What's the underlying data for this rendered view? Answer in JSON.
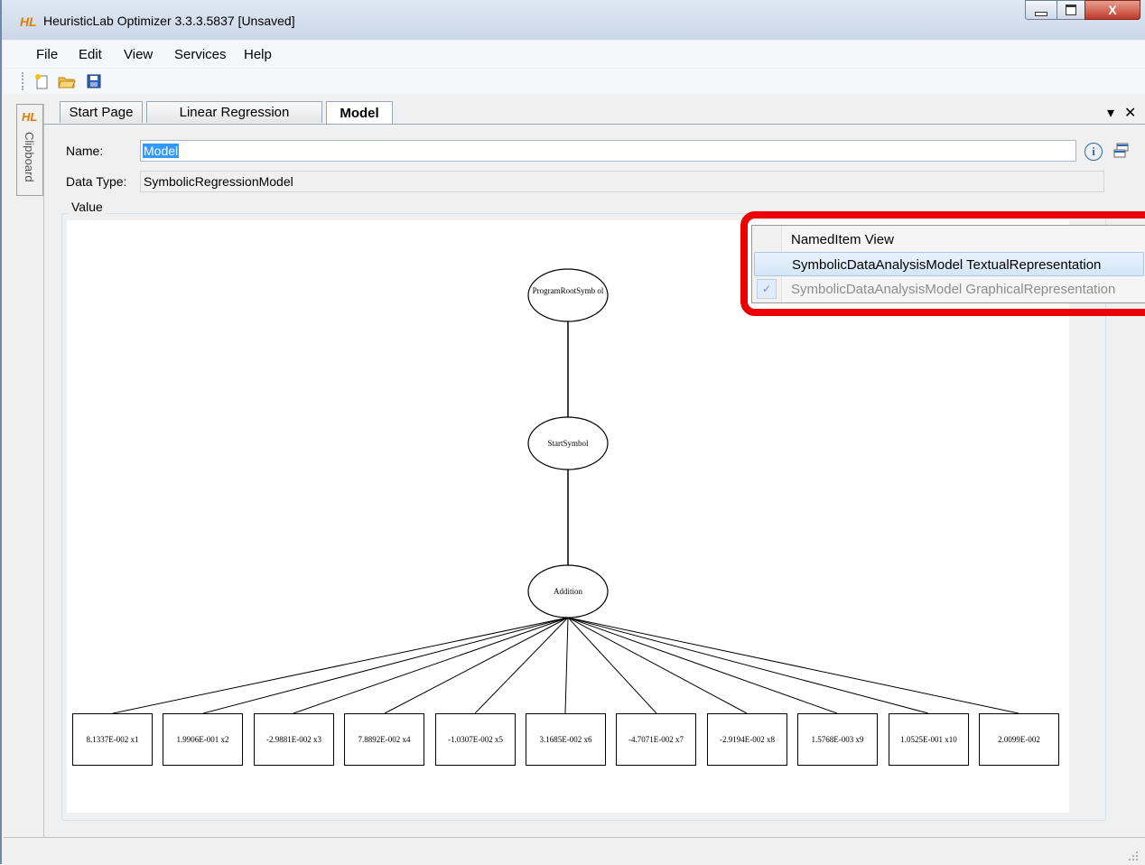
{
  "window": {
    "logo": "HL",
    "title": "HeuristicLab Optimizer 3.3.3.5837 [Unsaved]",
    "close_glyph": "X"
  },
  "menu": [
    "File",
    "Edit",
    "View",
    "Services",
    "Help"
  ],
  "sidebar": {
    "logo": "HL",
    "label": "Clipboard"
  },
  "tabs": [
    {
      "label": "Start Page"
    },
    {
      "label": "Linear Regression"
    },
    {
      "label": "Model",
      "active": true
    }
  ],
  "tab_controls": {
    "dropdown": "▾",
    "close": "✕"
  },
  "form": {
    "name_label": "Name:",
    "name_value": "Model",
    "type_label": "Data Type:",
    "type_value": "SymbolicRegressionModel",
    "value_label": "Value"
  },
  "tree": {
    "root": "ProgramRootSymb ol",
    "start": "StartSymbol",
    "addition": "Addition",
    "leaves": [
      "8.1337E-002 x1",
      "1.9906E-001 x2",
      "-2.9881E-002 x3",
      "7.8892E-002 x4",
      "-1.0307E-002 x5",
      "3.1685E-002 x6",
      "-4.7071E-002 x7",
      "-2.9194E-002 x8",
      "1.5768E-003 x9",
      "1.0525E-001 x10",
      "2.0099E-002"
    ]
  },
  "context_menu": {
    "items": [
      {
        "label": "NamedItem View",
        "state": "normal"
      },
      {
        "label": "SymbolicDataAnalysisModel TextualRepresentation",
        "state": "hover"
      },
      {
        "label": "SymbolicDataAnalysisModel GraphicalRepresentation",
        "state": "checked-disabled"
      }
    ],
    "checkmark": "✓",
    "highlight_color": "#ee0000"
  },
  "colors": {
    "accent": "#3399ff",
    "logo": "#e07b00"
  }
}
